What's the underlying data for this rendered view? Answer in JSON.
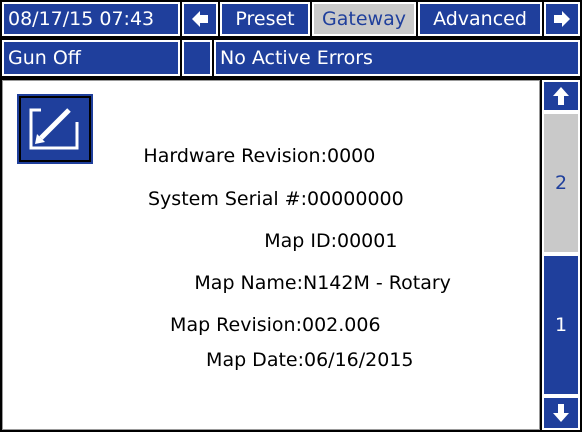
{
  "header": {
    "datetime": "08/17/15 07:43",
    "tabs": [
      {
        "label": "Preset"
      },
      {
        "label": "Gateway"
      },
      {
        "label": "Advanced"
      }
    ]
  },
  "status": {
    "gun": "Gun Off",
    "errors": "No Active Errors"
  },
  "info": {
    "hardware_revision": {
      "label": "Hardware Revision:",
      "value": "0000"
    },
    "system_serial": {
      "label": "System Serial #:",
      "value": "00000000"
    },
    "map_id": {
      "label": "Map ID:",
      "value": "00001"
    },
    "map_name": {
      "label": "Map Name:",
      "value": "N142M - Rotary"
    },
    "map_revision": {
      "label": "Map Revision:",
      "value": "002.006"
    },
    "map_date": {
      "label": "Map Date:",
      "value": "06/16/2015"
    }
  },
  "pages": {
    "page2": "2",
    "page1": "1"
  },
  "colors": {
    "accent_blue": "#1f3f9c",
    "selected_tab": "#c9c9c9"
  },
  "icons": [
    "left-arrow-icon",
    "right-arrow-icon",
    "edit-icon",
    "scroll-up-icon",
    "scroll-down-icon"
  ]
}
